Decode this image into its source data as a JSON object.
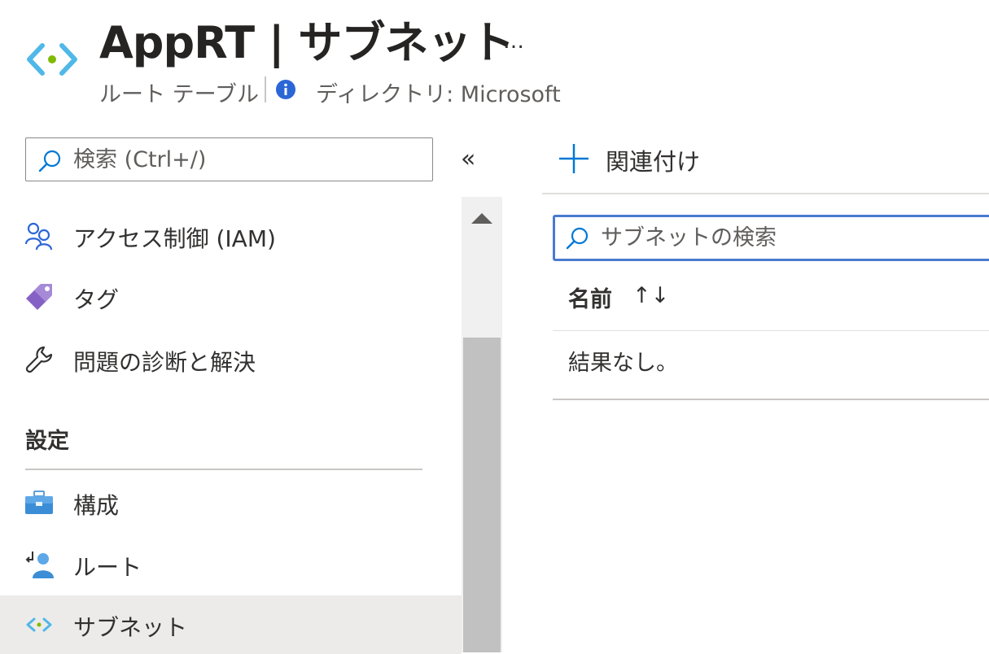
{
  "header": {
    "title": "AppRT | サブネット",
    "more_label": "…",
    "subtitle": "ルート テーブル",
    "directory": "ディレクトリ: Microsoft"
  },
  "sidebar": {
    "search_placeholder": "検索 (Ctrl+/)",
    "collapse_label": "«",
    "items": [
      {
        "label": "アクセス制御 (IAM)",
        "icon": "people-icon"
      },
      {
        "label": "タグ",
        "icon": "tag-icon"
      },
      {
        "label": "問題の診断と解決",
        "icon": "wrench-icon"
      }
    ],
    "section_title": "設定",
    "settings_items": [
      {
        "label": "構成",
        "icon": "toolbox-icon"
      },
      {
        "label": "ルート",
        "icon": "route-icon"
      },
      {
        "label": "サブネット",
        "icon": "subnet-icon",
        "selected": true
      }
    ]
  },
  "toolbar": {
    "add_label": "関連付け"
  },
  "main": {
    "search_placeholder": "サブネットの検索",
    "column_name": "名前",
    "sort_label": "↑↓",
    "empty_text": "結果なし。"
  },
  "colors": {
    "accent": "#0078d4",
    "focus_border": "#4a7ad0",
    "selected_bg": "#edebe9"
  }
}
